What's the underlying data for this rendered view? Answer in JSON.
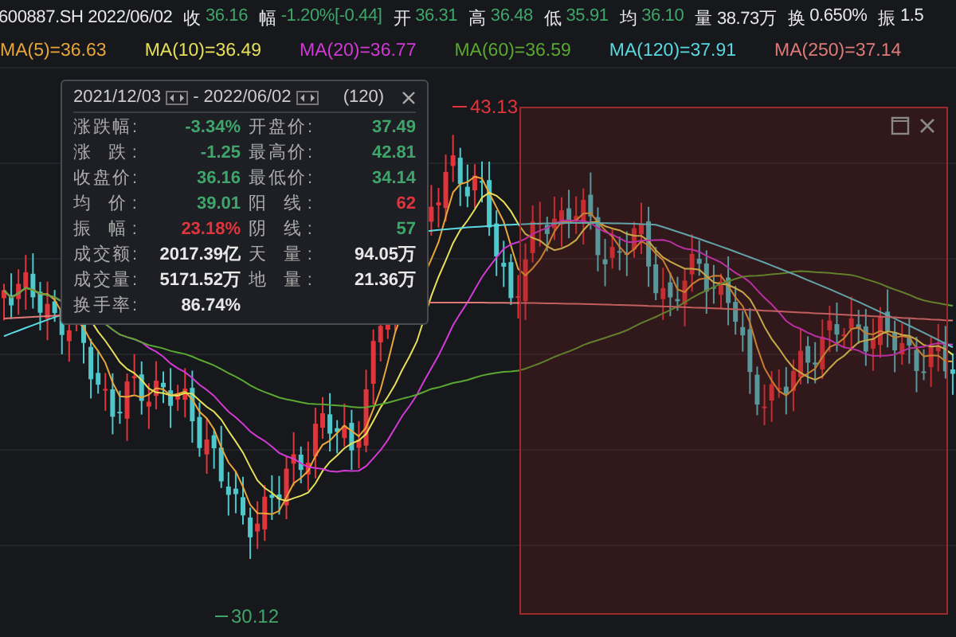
{
  "quote_bar": [
    {
      "label": "600887.SH 2022/06/02"
    },
    {
      "label": "收",
      "value": "36.16",
      "color": "#3fa56a"
    },
    {
      "label": "幅",
      "value": "-1.20%[-0.44]",
      "color": "#3fa56a"
    },
    {
      "label": "开",
      "value": "36.31",
      "color": "#3fa56a"
    },
    {
      "label": "高",
      "value": "36.48",
      "color": "#3fa56a"
    },
    {
      "label": "低",
      "value": "35.91",
      "color": "#3fa56a"
    },
    {
      "label": "均",
      "value": "36.10",
      "color": "#3fa56a"
    },
    {
      "label": "量",
      "value": "38.73万",
      "color": "#e8e8e8"
    },
    {
      "label": "换",
      "value": "0.650%",
      "color": "#e8e8e8"
    },
    {
      "label": "振",
      "value": "1.5",
      "color": "#e8e8e8"
    }
  ],
  "moving_averages": [
    {
      "label": "MA(5)=36.63",
      "color": "#e8a63a"
    },
    {
      "label": "MA(10)=36.49",
      "color": "#e6e05a"
    },
    {
      "label": "MA(20)=36.77",
      "color": "#d23ad6"
    },
    {
      "label": "MA(60)=36.59",
      "color": "#5aa832"
    },
    {
      "label": "MA(120)=37.91",
      "color": "#5ad8e0"
    },
    {
      "label": "MA(250)=37.14",
      "color": "#e07a78"
    }
  ],
  "chart": {
    "high_marker": "43.13",
    "low_marker": "30.12"
  },
  "range_panel": {
    "start": "2021/12/03",
    "separator": "-",
    "end": "2022/06/02",
    "count": "(120)",
    "cells": [
      {
        "label": "涨跌幅:",
        "value": "-3.34%",
        "color": "#3fa56a"
      },
      {
        "label": "开盘价:",
        "value": "37.49",
        "color": "#3fa56a"
      },
      {
        "label": "涨 跌:",
        "value": "-1.25",
        "color": "#3fa56a"
      },
      {
        "label": "最高价:",
        "value": "42.81",
        "color": "#3fa56a"
      },
      {
        "label": "收盘价:",
        "value": "36.16",
        "color": "#3fa56a"
      },
      {
        "label": "最低价:",
        "value": "34.14",
        "color": "#3fa56a"
      },
      {
        "label": "均 价:",
        "value": "39.01",
        "color": "#3fa56a"
      },
      {
        "label": "阳 线:",
        "value": "62",
        "color": "#e2353b"
      },
      {
        "label": "振 幅:",
        "value": "23.18%",
        "color": "#e2353b"
      },
      {
        "label": "阴 线:",
        "value": "57",
        "color": "#3fa56a"
      },
      {
        "label": "成交额:",
        "value": "2017.39亿",
        "color": "#e8e8e8"
      },
      {
        "label": "天 量:",
        "value": "94.05万",
        "color": "#e8e8e8"
      },
      {
        "label": "成交量:",
        "value": "5171.52万",
        "color": "#e8e8e8"
      },
      {
        "label": "地 量:",
        "value": "21.36万",
        "color": "#e8e8e8"
      },
      {
        "label": "换手率:",
        "value": "86.74%",
        "color": "#e8e8e8"
      }
    ]
  }
}
